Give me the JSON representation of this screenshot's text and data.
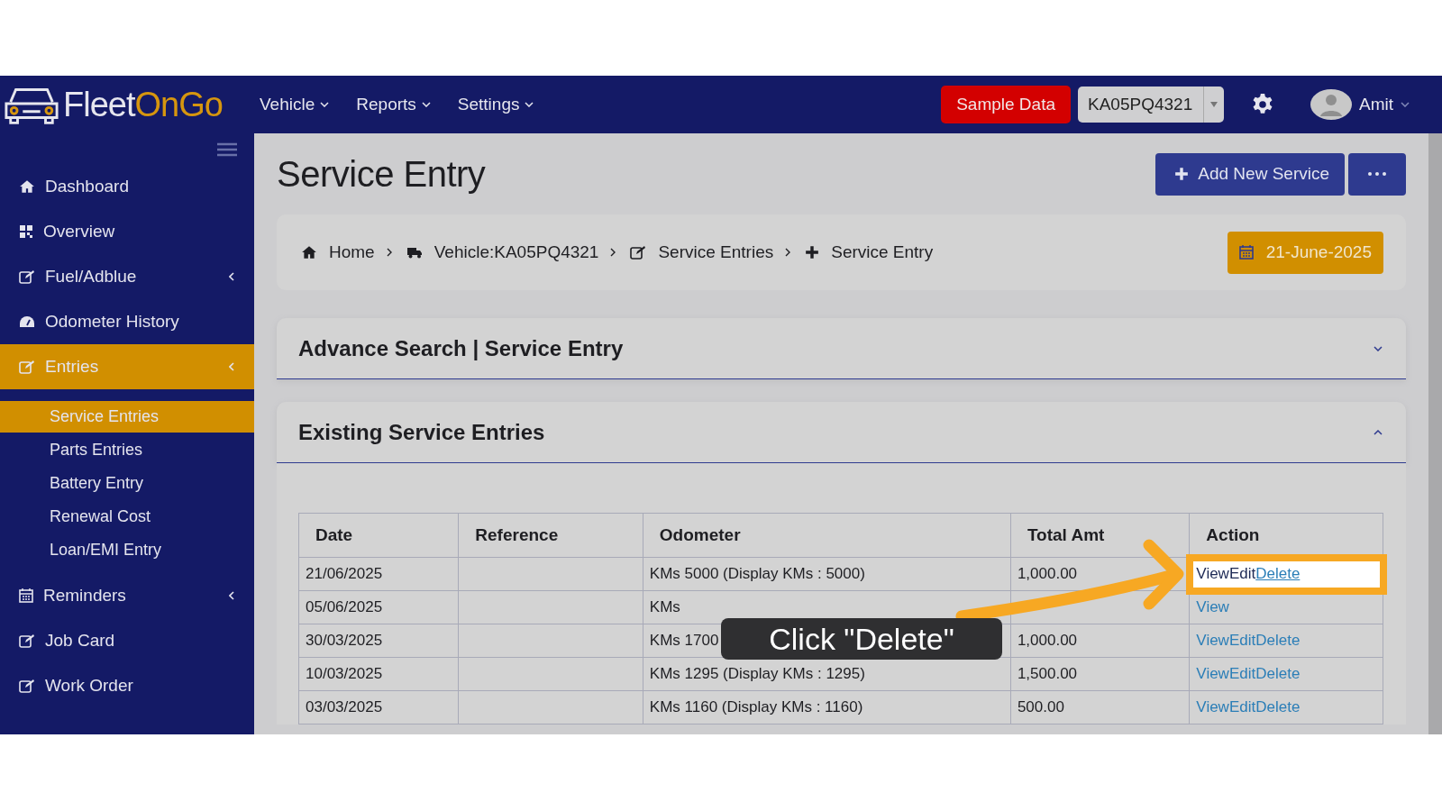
{
  "header": {
    "logo": {
      "text_1": "Fleet",
      "text_2": "OnGo"
    },
    "menus": [
      {
        "label": "Vehicle"
      },
      {
        "label": "Reports"
      },
      {
        "label": "Settings"
      }
    ],
    "sample_button": "Sample Data",
    "vehicle_select": {
      "value": "KA05PQ4321"
    },
    "user": {
      "name": "Amit"
    }
  },
  "sidebar": {
    "items": [
      {
        "label": "Dashboard",
        "selected": false,
        "submenu": false
      },
      {
        "label": "Overview",
        "selected": false,
        "submenu": false
      },
      {
        "label": "Fuel/Adblue",
        "selected": false,
        "submenu": true
      },
      {
        "label": "Odometer History",
        "selected": false,
        "submenu": false
      },
      {
        "label": "Entries",
        "selected": true,
        "submenu": true,
        "children": [
          {
            "label": "Service Entries",
            "selected": true
          },
          {
            "label": "Parts Entries",
            "selected": false
          },
          {
            "label": "Battery Entry",
            "selected": false
          },
          {
            "label": "Renewal Cost",
            "selected": false
          },
          {
            "label": "Loan/EMI Entry",
            "selected": false
          }
        ]
      },
      {
        "label": "Reminders",
        "selected": false,
        "submenu": true
      },
      {
        "label": "Job Card",
        "selected": false,
        "submenu": false
      },
      {
        "label": "Work Order",
        "selected": false,
        "submenu": false
      }
    ]
  },
  "page": {
    "title": "Service Entry",
    "add_button": "Add New Service",
    "breadcrumb": [
      {
        "label": "Home"
      },
      {
        "label": "Vehicle:KA05PQ4321"
      },
      {
        "label": "Service Entries"
      },
      {
        "label": "Service Entry"
      }
    ],
    "date": "21-June-2025"
  },
  "panels": [
    {
      "title": "Advance Search | Service Entry",
      "expanded": false
    },
    {
      "title": "Existing Service Entries",
      "expanded": true
    }
  ],
  "table": {
    "columns": [
      "Date",
      "Reference",
      "Odometer",
      "Total Amt",
      "Action"
    ],
    "rows": [
      {
        "date": "21/06/2025",
        "odometer": "KMs 5000 (Display KMs : 5000)",
        "total": "1,000.00",
        "actions": [
          "View",
          "Edit",
          "Delete"
        ],
        "highlighted": true
      },
      {
        "date": "05/06/2025",
        "odometer": "KMs",
        "actions": [
          "View"
        ],
        "highlighted": false
      },
      {
        "date": "30/03/2025",
        "odometer": "KMs 1700",
        "total": "1,000.00",
        "actions": [
          "View",
          "Edit",
          "Delete"
        ],
        "highlighted": false
      },
      {
        "date": "10/03/2025",
        "odometer": "KMs 1295 (Display KMs : 1295)",
        "total": "1,500.00",
        "actions": [
          "View",
          "Edit",
          "Delete"
        ],
        "highlighted": false
      },
      {
        "date": "03/03/2025",
        "odometer": "KMs 1160 (Display KMs : 1160)",
        "total": "500.00",
        "actions": [
          "View",
          "Edit",
          "Delete"
        ],
        "highlighted": false
      }
    ]
  },
  "callout": {
    "text": "Click \"Delete\""
  }
}
